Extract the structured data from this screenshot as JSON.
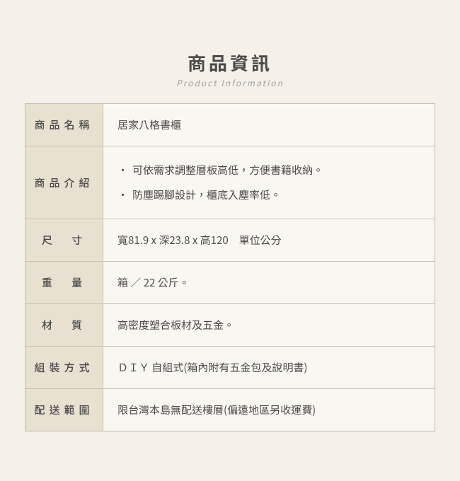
{
  "header": {
    "title": "商品資訊",
    "subtitle": "Product  Information"
  },
  "rows": [
    {
      "label": "商品名稱",
      "label_spacing": "normal",
      "value": "居家八格書櫃",
      "type": "text"
    },
    {
      "label": "商品介紹",
      "label_spacing": "normal",
      "type": "description",
      "items": [
        "可依需求調整層板高低，方便書籍收納。",
        "防塵踢腳設計，櫃底入塵率低。"
      ]
    },
    {
      "label": "尺　寸",
      "label_spacing": "wide",
      "value": "寬81.9 x 深23.8 x 高120　單位公分",
      "type": "text"
    },
    {
      "label": "重　量",
      "label_spacing": "wide",
      "value": "箱 ／ 22 公斤。",
      "type": "text"
    },
    {
      "label": "材　質",
      "label_spacing": "wide",
      "value": "高密度塑合板材及五金。",
      "type": "text"
    },
    {
      "label": "組裝方式",
      "label_spacing": "normal",
      "value": "ＤＩＹ 自組式(箱內附有五金包及說明書)",
      "type": "text"
    },
    {
      "label": "配送範圍",
      "label_spacing": "normal",
      "value": "限台灣本島無配送樓層(偏遠地區另收運費)",
      "type": "text"
    }
  ]
}
